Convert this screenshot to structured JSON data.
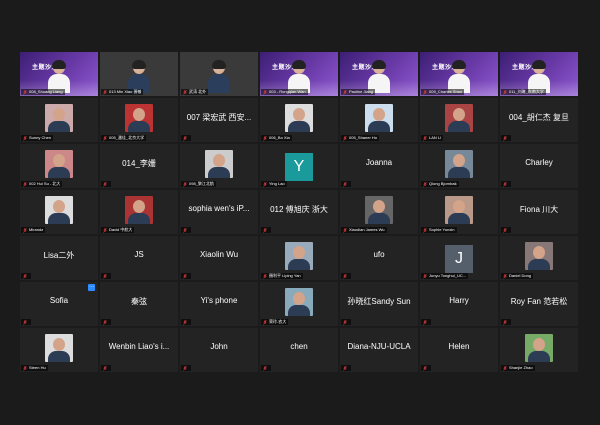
{
  "meeting": {
    "mic_muted_icon": "mic-muted-icon",
    "active_speaker_color": "#f2c744",
    "raise_glyph": "···",
    "tiles": [
      {
        "name": "008_Shuang Liang",
        "display": "",
        "type": "banner",
        "active": true,
        "banner_text": "主题沙龙"
      },
      {
        "name": "013 Min Xiao 萧敏",
        "display": "",
        "type": "video"
      },
      {
        "name": "武涛 北外",
        "display": "",
        "type": "video"
      },
      {
        "name": "003 - Rongqian Wan",
        "display": "",
        "type": "banner",
        "banner_text": "主题沙龙"
      },
      {
        "name": "Pauline Jiang",
        "display": "",
        "type": "banner",
        "banner_text": "主题沙龙"
      },
      {
        "name": "009_Charles Shao",
        "display": "",
        "type": "banner",
        "banner_text": "主题沙龙"
      },
      {
        "name": "011_刘琳_东南大学",
        "display": "",
        "type": "banner",
        "banner_text": "主题沙龙"
      },
      {
        "name": "Sunny Chen",
        "display": "",
        "type": "photo",
        "color": "#caa"
      },
      {
        "name": "005_潘佳_北京大学",
        "display": "",
        "type": "photo",
        "color": "#b33"
      },
      {
        "name": "",
        "display": "007 梁宏武 西安...",
        "type": "name"
      },
      {
        "name": "006_Bo Xia",
        "display": "",
        "type": "photo",
        "color": "#ddd"
      },
      {
        "name": "005_Shaner Ho",
        "display": "",
        "type": "photo",
        "color": "#cde"
      },
      {
        "name": "LAN LI",
        "display": "",
        "type": "photo",
        "color": "#a44"
      },
      {
        "name": "",
        "display": "004_胡仁杰 复旦",
        "type": "name"
      },
      {
        "name": "002 Hui Su - 北大",
        "display": "",
        "type": "photo",
        "color": "#c88"
      },
      {
        "name": "",
        "display": "014_李姗",
        "type": "name"
      },
      {
        "name": "098_黎江北航",
        "display": "",
        "type": "photo",
        "color": "#ccc"
      },
      {
        "name": "Ying Lao",
        "display": "Y",
        "type": "initial",
        "color": "#1a9a9a"
      },
      {
        "name": "",
        "display": "Joanna",
        "type": "name"
      },
      {
        "name": "Qiong Bjornbak",
        "display": "",
        "type": "photo",
        "color": "#789"
      },
      {
        "name": "",
        "display": "Charley",
        "type": "name"
      },
      {
        "name": "Miranda",
        "display": "",
        "type": "photo",
        "color": "#ddd"
      },
      {
        "name": "David 中航大",
        "display": "",
        "type": "photo",
        "color": "#a33"
      },
      {
        "name": "",
        "display": "sophia wen's iP...",
        "type": "name"
      },
      {
        "name": "",
        "display": "012 傅旭庆 浙大",
        "type": "name"
      },
      {
        "name": "Xiaodian James Wu",
        "display": "",
        "type": "photo",
        "color": "#666"
      },
      {
        "name": "Sophie Yunxin",
        "display": "",
        "type": "photo",
        "color": "#b98"
      },
      {
        "name": "",
        "display": "Fiona 川大",
        "type": "name"
      },
      {
        "name": "",
        "display": "Lisa二外",
        "type": "name"
      },
      {
        "name": "",
        "display": "JS",
        "type": "name"
      },
      {
        "name": "",
        "display": "Xiaolin Wu",
        "type": "name"
      },
      {
        "name": "顏利平 Liping Yan",
        "display": "",
        "type": "photo",
        "color": "#9ab"
      },
      {
        "name": "",
        "display": "ufo",
        "type": "name"
      },
      {
        "name": "Junyu Tonghui_UC...",
        "display": "J",
        "type": "initial",
        "color": "#555f6b"
      },
      {
        "name": "Daniel Dong",
        "display": "",
        "type": "photo",
        "color": "#877"
      },
      {
        "name": "",
        "display": "Sofia",
        "type": "name",
        "raised": true
      },
      {
        "name": "",
        "display": "秦弦",
        "type": "name"
      },
      {
        "name": "",
        "display": "Yi's phone",
        "type": "name"
      },
      {
        "name": "荣玲-农大",
        "display": "",
        "type": "photo",
        "color": "#8ab"
      },
      {
        "name": "",
        "display": "孙晓红Sandy Sun",
        "type": "name"
      },
      {
        "name": "",
        "display": "Harry",
        "type": "name"
      },
      {
        "name": "",
        "display": "Roy Fan 范若松",
        "type": "name"
      },
      {
        "name": "Steen Hu",
        "display": "",
        "type": "photo",
        "color": "#ddd"
      },
      {
        "name": "",
        "display": "Wenbin Liao's i...",
        "type": "name"
      },
      {
        "name": "",
        "display": "John",
        "type": "name"
      },
      {
        "name": "",
        "display": "chen",
        "type": "name"
      },
      {
        "name": "",
        "display": "Diana-NJU-UCLA",
        "type": "name"
      },
      {
        "name": "",
        "display": "Helen",
        "type": "name"
      },
      {
        "name": "Shanjie Zhao",
        "display": "",
        "type": "photo",
        "color": "#7a6"
      }
    ]
  }
}
